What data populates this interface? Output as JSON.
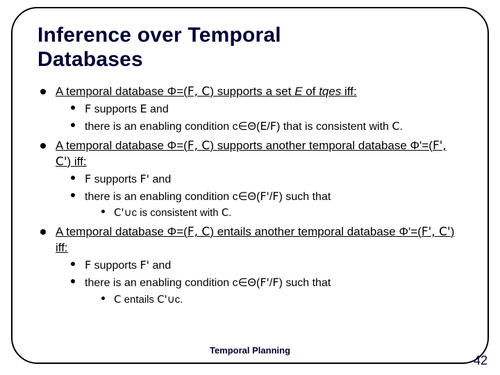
{
  "title_line1": "Inference over Temporal",
  "title_line2": "Databases",
  "bullets": {
    "b1": {
      "prefix": "A ",
      "u_a": "temporal database",
      "mid1": " Φ=(",
      "fc": "F, C",
      "mid2": ") ",
      "u_b": "supports",
      "mid3": " a set ",
      "E": "E",
      "mid4": " of ",
      "u_c": "tqes",
      "suffix": " iff:",
      "sub1_a": "F",
      "sub1_b": " supports ",
      "sub1_c": "E",
      "sub1_d": " and",
      "sub2_a": "there is an enabling condition c∈Θ(",
      "sub2_b": "E",
      "sub2_c": "/",
      "sub2_d": "F",
      "sub2_e": ") that is consistent with ",
      "sub2_f": "C",
      "sub2_g": "."
    },
    "b2": {
      "prefix": "A ",
      "u_a": "temporal database",
      "mid1": " Φ=(",
      "fc": "F, C",
      "mid2": ") ",
      "u_b": "supports",
      "mid3": " another temporal database Φ'=(",
      "fc2": "F', C'",
      "mid4": ") iff:",
      "sub1_a": "F",
      "sub1_b": " supports ",
      "sub1_c": "F'",
      "sub1_d": " and",
      "sub2_a": "there is an enabling condition c∈Θ(",
      "sub2_b": "F'",
      "sub2_c": "/",
      "sub2_d": "F",
      "sub2_e": ") such that",
      "subsub_a": "C'",
      "subsub_b": "∪c is consistent with ",
      "subsub_c": "C",
      "subsub_d": "."
    },
    "b3": {
      "prefix": "A ",
      "u_a": "temporal database",
      "mid1": " Φ=(",
      "fc": "F, C",
      "mid2": ") ",
      "u_b": "entails",
      "mid3": " another temporal database Φ'=(",
      "fc2": "F', C'",
      "mid4": ") iff:",
      "sub1_a": "F",
      "sub1_b": " supports ",
      "sub1_c": "F'",
      "sub1_d": " and",
      "sub2_a": "there is an enabling condition c∈Θ(",
      "sub2_b": "F'",
      "sub2_c": "/",
      "sub2_d": "F",
      "sub2_e": ") such that",
      "subsub_a": "C",
      "subsub_b": " entails ",
      "subsub_c": "C'",
      "subsub_d": "∪c."
    }
  },
  "footer": {
    "center": "Temporal Planning",
    "page": "42"
  }
}
